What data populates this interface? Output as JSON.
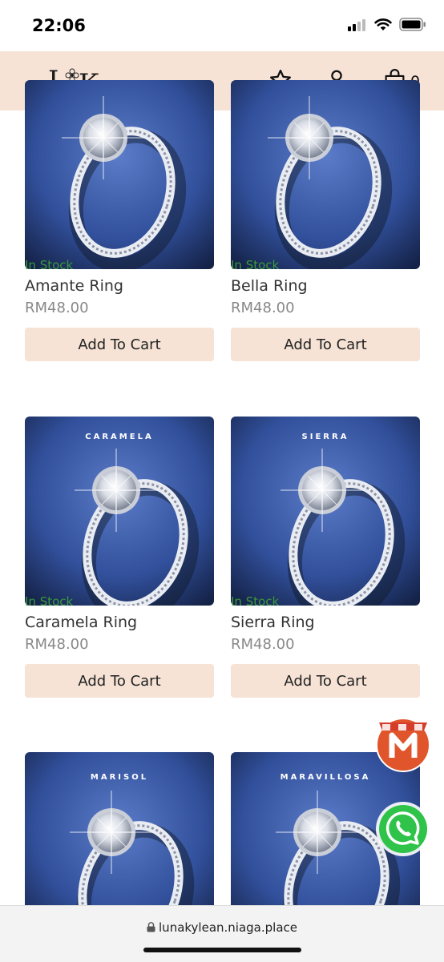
{
  "status": {
    "time": "22:06"
  },
  "header": {
    "cart_count": "0"
  },
  "products": [
    {
      "stock": "In Stock",
      "name": "Amante Ring",
      "price": "RM48.00",
      "button": "Add To Cart",
      "image_label": ""
    },
    {
      "stock": "In Stock",
      "name": "Bella Ring",
      "price": "RM48.00",
      "button": "Add To Cart",
      "image_label": ""
    },
    {
      "stock": "In Stock",
      "name": "Caramela Ring",
      "price": "RM48.00",
      "button": "Add To Cart",
      "image_label": "CARAMELA"
    },
    {
      "stock": "In Stock",
      "name": "Sierra Ring",
      "price": "RM48.00",
      "button": "Add To Cart",
      "image_label": "SIERRA"
    },
    {
      "image_label": "MARISOL"
    },
    {
      "image_label": "MARAVILLOSA"
    }
  ],
  "browser": {
    "url": "lunakylean.niaga.place"
  },
  "colors": {
    "header_bg": "#f6e3d6",
    "button_bg": "#f6e3d6",
    "in_stock": "#3a9a3a",
    "price": "#888888"
  },
  "icons": [
    "star-icon",
    "user-icon",
    "shopping-bag-icon",
    "lock-icon",
    "whatsapp-icon",
    "niaga-shop-icon"
  ]
}
